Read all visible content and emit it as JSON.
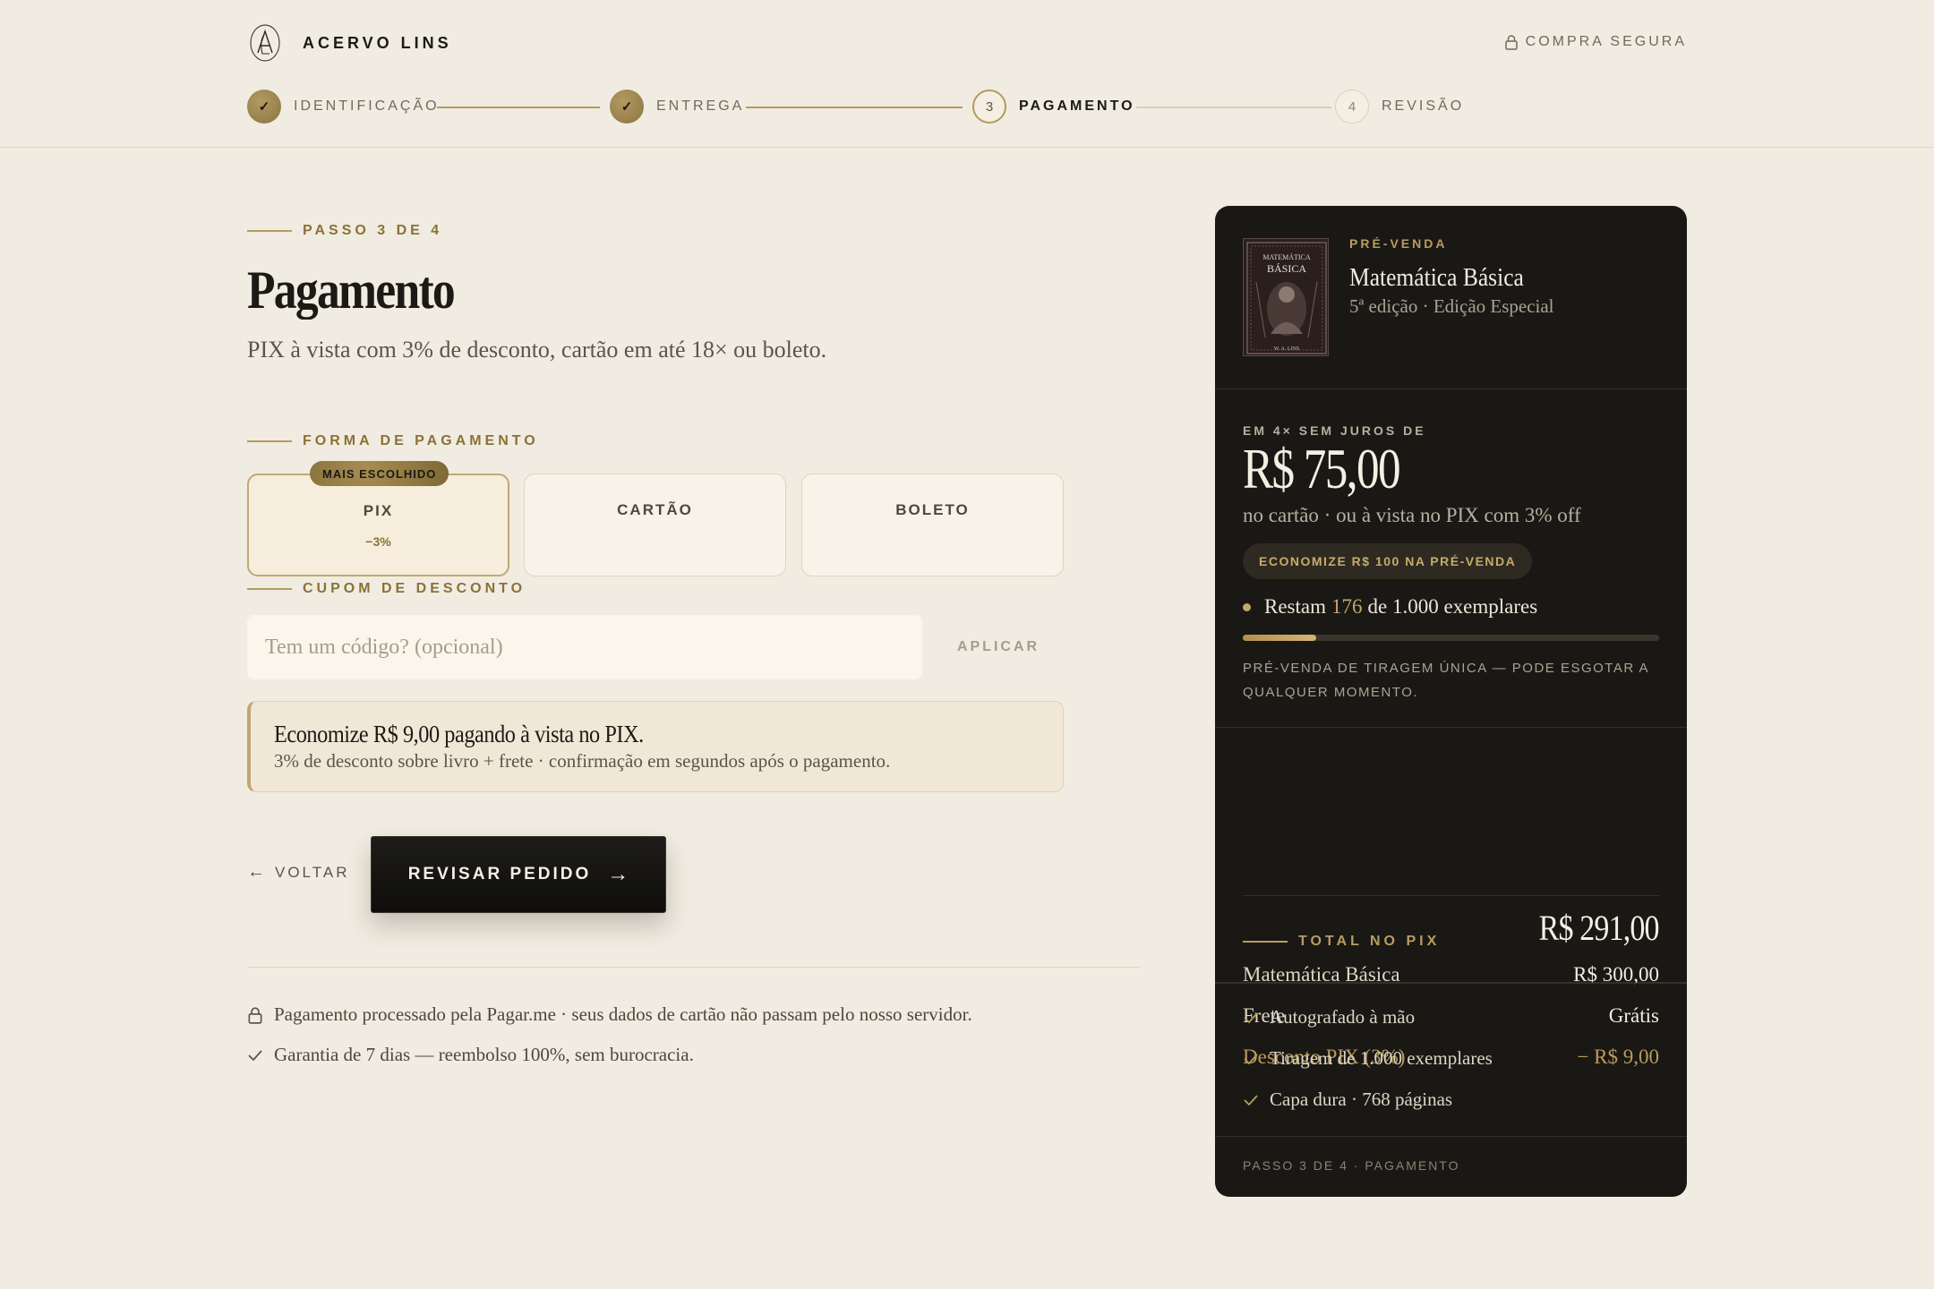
{
  "header": {
    "brand_name": "ACERVO LINS",
    "secure_label": "COMPRA SEGURA"
  },
  "stepper": {
    "steps": [
      {
        "number": "✓",
        "label": "IDENTIFICAÇÃO",
        "state": "done"
      },
      {
        "number": "✓",
        "label": "ENTREGA",
        "state": "done"
      },
      {
        "number": "3",
        "label": "PAGAMENTO",
        "state": "active"
      },
      {
        "number": "4",
        "label": "REVISÃO",
        "state": "todo"
      }
    ]
  },
  "main": {
    "step_eyebrow": "PASSO 3 DE 4",
    "title": "Pagamento",
    "subtitle": "PIX à vista com 3% de desconto, cartão em até 18× ou boleto.",
    "payment_section_label": "FORMA DE PAGAMENTO",
    "payment_options": [
      {
        "label": "PIX",
        "discount": "−3%",
        "badge": "MAIS ESCOLHIDO",
        "selected": true
      },
      {
        "label": "CARTÃO",
        "selected": false
      },
      {
        "label": "BOLETO",
        "selected": false
      }
    ],
    "coupon_section_label": "CUPOM DE DESCONTO",
    "coupon_placeholder": "Tem um código? (opcional)",
    "coupon_value": "",
    "apply_label": "APLICAR",
    "pix_note_title": "Economize R$ 9,00 pagando à vista no PIX.",
    "pix_note_body": "3% de desconto sobre livro + frete · confirmação em segundos após o pagamento.",
    "back_label": "VOLTAR",
    "review_label": "REVISAR PEDIDO",
    "footer_lines": [
      "Pagamento processado pela Pagar.me · seus dados de cartão não passam pelo nosso servidor.",
      "Garantia de 7 dias — reembolso 100%, sem burocracia."
    ]
  },
  "summary": {
    "product_tag": "PRÉ-VENDA",
    "product_name": "Matemática Básica",
    "product_edition": "5ª edição · Edição Especial",
    "cover_text": {
      "line1": "MATEMÁTICA",
      "line2": "BÁSICA",
      "author": "W. A. LINS"
    },
    "installment_label": "EM 4× SEM JUROS DE",
    "installment_price": "R$ 75,00",
    "installment_sub": "no cartão · ou à vista no PIX com 3% off",
    "savings_badge": "ECONOMIZE R$ 100 NA PRÉ-VENDA",
    "stock_prefix": "Restam",
    "stock_remaining": "176",
    "stock_suffix": "de 1.000 exemplares",
    "stock_fraction": 0.176,
    "stock_note": "PRÉ-VENDA DE TIRAGEM ÚNICA — PODE ESGOTAR A QUALQUER MOMENTO.",
    "lines": [
      {
        "label": "Matemática Básica",
        "value": "R$ 300,00",
        "type": "normal"
      },
      {
        "label": "Frete",
        "value": "Grátis",
        "type": "normal"
      },
      {
        "label": "Desconto PIX (3%)",
        "value": "− R$ 9,00",
        "type": "discount"
      }
    ],
    "total_label": "TOTAL NO PIX",
    "total_value": "R$ 291,00",
    "features": [
      "Autografado à mão",
      "Tiragem de 1.000 exemplares",
      "Capa dura · 768 páginas"
    ],
    "footer": "PASSO 3 DE 4 · PAGAMENTO"
  },
  "colors": {
    "accent_gold": "#b59b5f",
    "background": "#f0ece1",
    "card_dark": "#1a1815"
  }
}
